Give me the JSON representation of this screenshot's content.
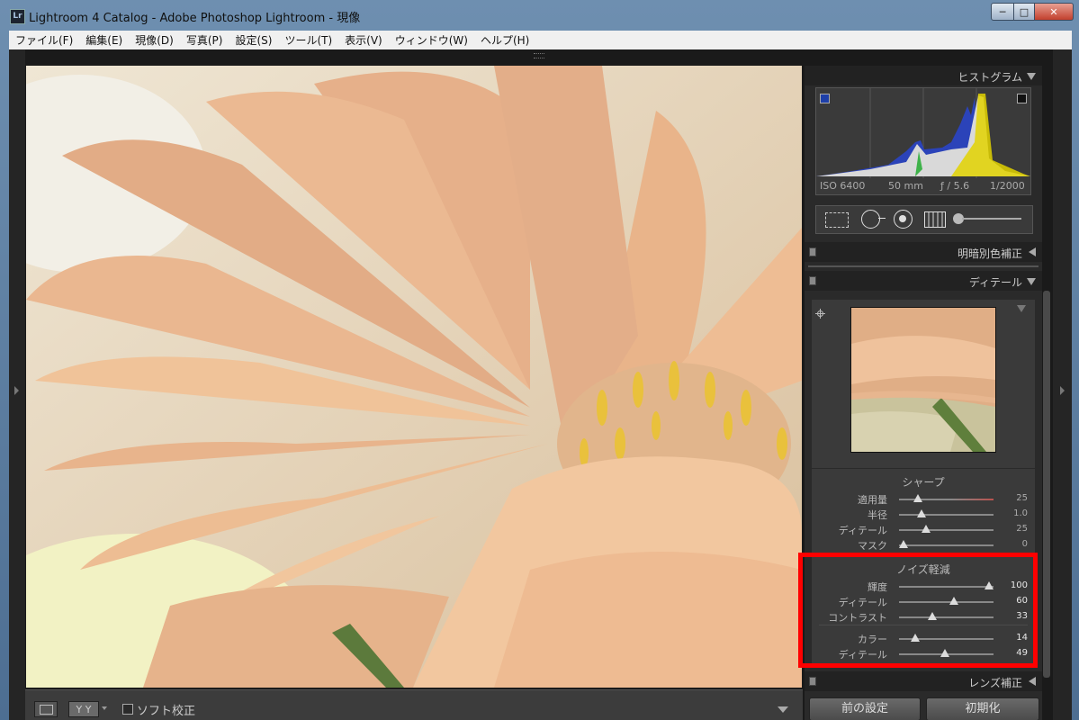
{
  "window": {
    "app_icon": "Lr",
    "title": "Lightroom 4 Catalog - Adobe Photoshop Lightroom - 現像",
    "controls": {
      "minimize": "─",
      "maximize": "□",
      "close": "✕"
    }
  },
  "menu": [
    "ファイル(F)",
    "編集(E)",
    "現像(D)",
    "写真(P)",
    "設定(S)",
    "ツール(T)",
    "表示(V)",
    "ウィンドウ(W)",
    "ヘルプ(H)"
  ],
  "toolbar": {
    "compare_label": "Y Y",
    "soft_proof_label": "ソフト校正"
  },
  "panels": {
    "histogram": {
      "title": "ヒストグラム",
      "iso": "ISO 6400",
      "focal": "50 mm",
      "aperture": "ƒ / 5.6",
      "shutter": "1/2000"
    },
    "tone_curve_title": "明暗別色補正",
    "detail": {
      "title": "ディテール",
      "sharpen": {
        "title": "シャープ",
        "rows": [
          {
            "label": "適用量",
            "value": "25",
            "pos": 0.2
          },
          {
            "label": "半径",
            "value": "1.0",
            "pos": 0.24
          },
          {
            "label": "ディテール",
            "value": "25",
            "pos": 0.29
          },
          {
            "label": "マスク",
            "value": "0",
            "pos": 0.05
          }
        ]
      },
      "noise": {
        "title": "ノイズ軽減",
        "rows": [
          {
            "label": "輝度",
            "value": "100",
            "pos": 0.95
          },
          {
            "label": "ディテール",
            "value": "60",
            "pos": 0.58
          },
          {
            "label": "コントラスト",
            "value": "33",
            "pos": 0.35
          },
          {
            "label": "カラー",
            "value": "14",
            "pos": 0.17
          },
          {
            "label": "ディテール",
            "value": "49",
            "pos": 0.49
          }
        ]
      }
    },
    "lens_title": "レンズ補正"
  },
  "buttons": {
    "previous": "前の設定",
    "reset": "初期化"
  },
  "colors": {
    "highlight": "#ff0000",
    "panel_bg": "#3a3a3a"
  }
}
